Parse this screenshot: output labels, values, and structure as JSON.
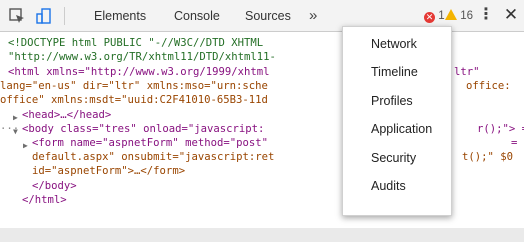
{
  "toolbar": {
    "inspect_icon": "inspect-element-icon",
    "device_icon": "device-toolbar-icon",
    "tabs": [
      "Elements",
      "Console",
      "Sources"
    ],
    "more_tabs": "»",
    "errors": {
      "icon": "error-icon",
      "count": "1"
    },
    "warnings": {
      "icon": "warning-icon",
      "count": "16"
    },
    "menu_icon": "⋮",
    "close_icon": "✕"
  },
  "code_lines": [
    "<!DOCTYPE html PUBLIC \"-//W3C//DTD XHTML",
    "\"http://www.w3.org/TR/xhtml11/DTD/xhtml11-",
    "<html xmlns=\"http://www.w3.org/1999/xhtml",
    "lang=\"en-us\" dir=\"ltr\" xmlns:mso=\"urn:sche",
    "office\" xmlns:msdt=\"uuid:C2F41010-65B3-11d",
    "<head>…</head>",
    "<body class=\"tres\" onload=\"javascript:",
    "<form name=\"aspnetForm\" method=\"post\"",
    "default.aspx\" onsubmit=\"javascript:ret",
    "id=\"aspnetForm\">…</form>",
    "</body>",
    "</html>"
  ],
  "code_right_fragments": {
    "html_ltr": "ltr\"",
    "office_ns": "office:",
    "body_tail": "r();\"> =",
    "form_eq": "=",
    "form_tail": "t();\" $0"
  },
  "menu": {
    "items": [
      "Network",
      "Timeline",
      "Profiles",
      "Application",
      "Security",
      "Audits"
    ]
  }
}
